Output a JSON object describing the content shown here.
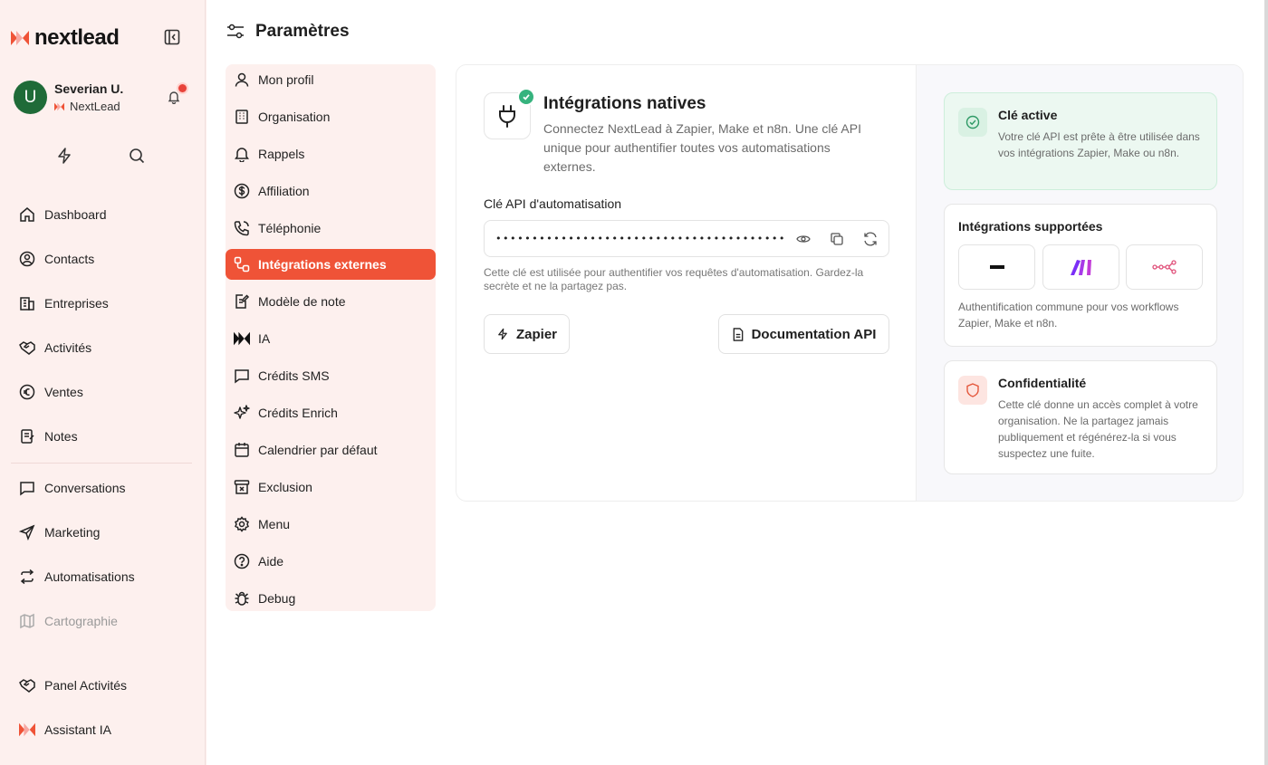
{
  "app": {
    "name": "nextlead",
    "accent": "#ef5337"
  },
  "user": {
    "initial": "U",
    "name": "Severian U.",
    "org": "NextLead",
    "avatar_color": "#1f6b38"
  },
  "nav": {
    "items": [
      {
        "label": "Dashboard",
        "icon": "home-icon"
      },
      {
        "label": "Contacts",
        "icon": "user-circle-icon"
      },
      {
        "label": "Entreprises",
        "icon": "building-icon"
      },
      {
        "label": "Activités",
        "icon": "handshake-icon"
      },
      {
        "label": "Ventes",
        "icon": "euro-icon"
      },
      {
        "label": "Notes",
        "icon": "note-icon"
      },
      {
        "label": "Conversations",
        "icon": "chat-icon"
      },
      {
        "label": "Marketing",
        "icon": "send-icon"
      },
      {
        "label": "Automatisations",
        "icon": "repeat-icon"
      },
      {
        "label": "Cartographie",
        "icon": "map-icon",
        "disabled": true
      }
    ],
    "bottom": [
      {
        "label": "Panel Activités",
        "icon": "handshake-icon"
      },
      {
        "label": "Assistant IA",
        "icon": "nextlead-logo-icon"
      }
    ]
  },
  "page": {
    "title": "Paramètres"
  },
  "settings_nav": [
    {
      "label": "Mon profil",
      "icon": "user-icon"
    },
    {
      "label": "Organisation",
      "icon": "building-icon"
    },
    {
      "label": "Rappels",
      "icon": "bell-icon"
    },
    {
      "label": "Affiliation",
      "icon": "dollar-icon"
    },
    {
      "label": "Téléphonie",
      "icon": "phone-icon"
    },
    {
      "label": "Intégrations externes",
      "icon": "integrations-icon",
      "active": true
    },
    {
      "label": "Modèle de note",
      "icon": "note-edit-icon"
    },
    {
      "label": "IA",
      "icon": "nextlead-logo-icon"
    },
    {
      "label": "Crédits SMS",
      "icon": "message-icon"
    },
    {
      "label": "Crédits Enrich",
      "icon": "sparkles-icon"
    },
    {
      "label": "Calendrier par défaut",
      "icon": "calendar-icon"
    },
    {
      "label": "Exclusion",
      "icon": "archive-x-icon"
    },
    {
      "label": "Menu",
      "icon": "gear-icon"
    },
    {
      "label": "Aide",
      "icon": "help-icon"
    },
    {
      "label": "Debug",
      "icon": "bug-icon"
    }
  ],
  "integrations": {
    "title": "Intégrations natives",
    "description": "Connectez NextLead à Zapier, Make et n8n. Une clé API unique pour authentifier toutes vos automatisations externes.",
    "api_label": "Clé API d'automatisation",
    "api_value": "••••••••••••••••••••••••••••••••••••••••••",
    "api_help": "Cette clé est utilisée pour authentifier vos requêtes d'automatisation. Gardez-la secrète et ne la partagez pas.",
    "zapier_button": "Zapier",
    "docs_button": "Documentation API"
  },
  "cards": {
    "active": {
      "title": "Clé active",
      "text": "Votre clé API est prête à être utilisée dans vos intégrations Zapier, Make ou n8n."
    },
    "supported": {
      "title": "Intégrations supportées",
      "text": "Authentification commune pour vos workflows Zapier, Make et n8n."
    },
    "privacy": {
      "title": "Confidentialité",
      "text": "Cette clé donne un accès complet à votre organisation. Ne la partagez jamais publiquement et régénérez-la si vous suspectez une fuite."
    }
  }
}
